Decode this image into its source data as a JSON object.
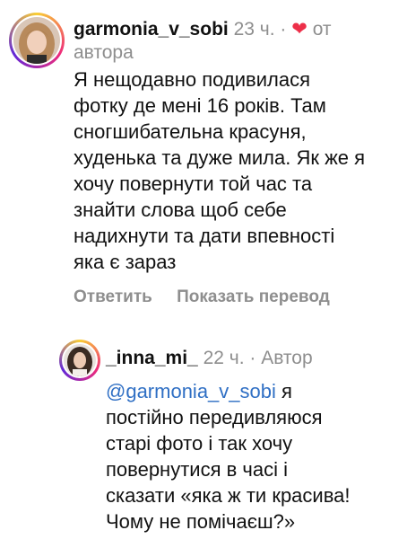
{
  "comment": {
    "username": "garmonia_v_sobi",
    "time": "23 ч.",
    "separator": "·",
    "liked_by_author_label": "от автора",
    "text_lines": [
      "Я нещодавно подивилася",
      "фотку де мені 16 років. Там",
      "сногшибательна красуня,",
      "худенька та дуже мила. Як же я",
      "хочу повернути той час та",
      "знайти слова щоб себе",
      "надихнути та дати впевності",
      "яка є зараз"
    ],
    "actions": {
      "reply": "Ответить",
      "translate": "Показать перевод"
    }
  },
  "reply": {
    "username": "_inna_mi_",
    "time": "22 ч.",
    "separator": "·",
    "author_badge": "Автор",
    "mention": "@garmonia_v_sobi",
    "first_line_rest": " я",
    "text_lines": [
      "постійно передивляюся",
      "старі фото і так хочу",
      "повернутися в часі і",
      "сказати «яка ж ти красива!",
      "Чому не помічаєш?»"
    ]
  },
  "colors": {
    "heart": "#ed2f49",
    "mention": "#2f6fc4",
    "muted": "#8e8e8e"
  },
  "icons": {
    "liked": "heart-icon"
  }
}
